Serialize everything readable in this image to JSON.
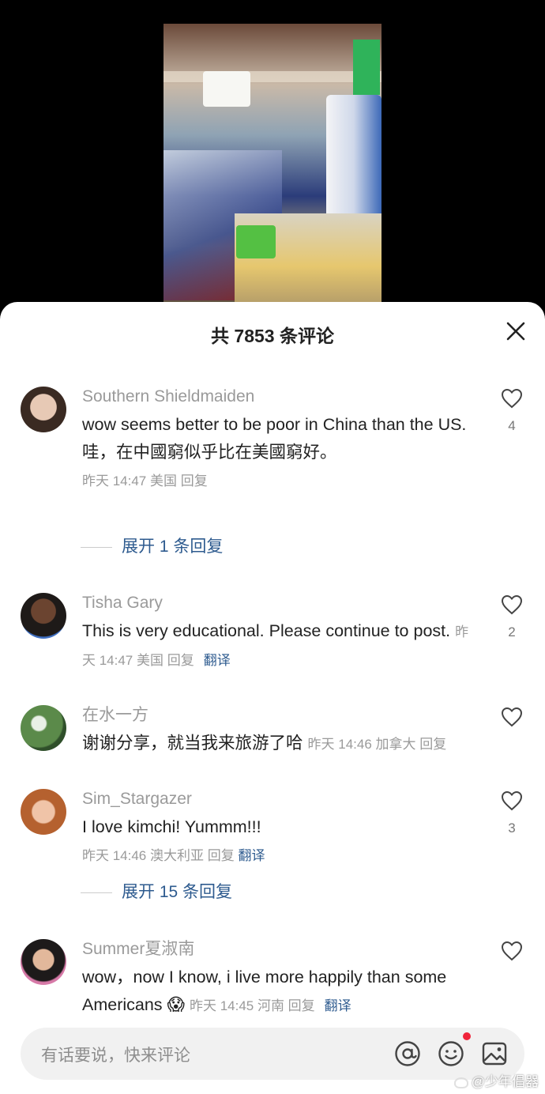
{
  "sheet": {
    "title": "共 7853 条评论"
  },
  "comments": [
    {
      "user": "Southern Shieldmaiden",
      "text": "wow seems better to be poor in China than the US.",
      "text2": "哇，在中國窮似乎比在美國窮好。",
      "meta": "昨天 14:47 美国 回复",
      "likes": "4",
      "expand": "展开 1 条回复"
    },
    {
      "user": "Tisha Gary",
      "text": "This is very educational. Please continue to post.",
      "meta": "昨天 14:47 美国 回复",
      "translate": "翻译",
      "likes": "2"
    },
    {
      "user": "在水一方",
      "text": "谢谢分享，就当我来旅游了哈",
      "meta": "昨天 14:46 加拿大 回复",
      "likes": ""
    },
    {
      "user": "Sim_Stargazer",
      "text": "I love kimchi! Yummm!!!",
      "meta": "昨天 14:46 澳大利亚 回复",
      "translate": "翻译",
      "likes": "3",
      "expand": "展开 15 条回复"
    },
    {
      "user": "Summer夏淑南",
      "text": "wow，now I know, i live more happily than some Americans",
      "emoji": "😱",
      "meta": "昨天 14:45 河南 回复",
      "translate": "翻译",
      "likes": ""
    }
  ],
  "input": {
    "placeholder": "有话要说，快来评论"
  },
  "watermark": "@少年倡器",
  "icons": [
    "close-icon",
    "heart-icon",
    "at-icon",
    "emoji-icon",
    "image-icon"
  ],
  "colors": {
    "accent": "#2e5b8f",
    "muted": "#9a9a9a",
    "badge": "#f0243a"
  }
}
